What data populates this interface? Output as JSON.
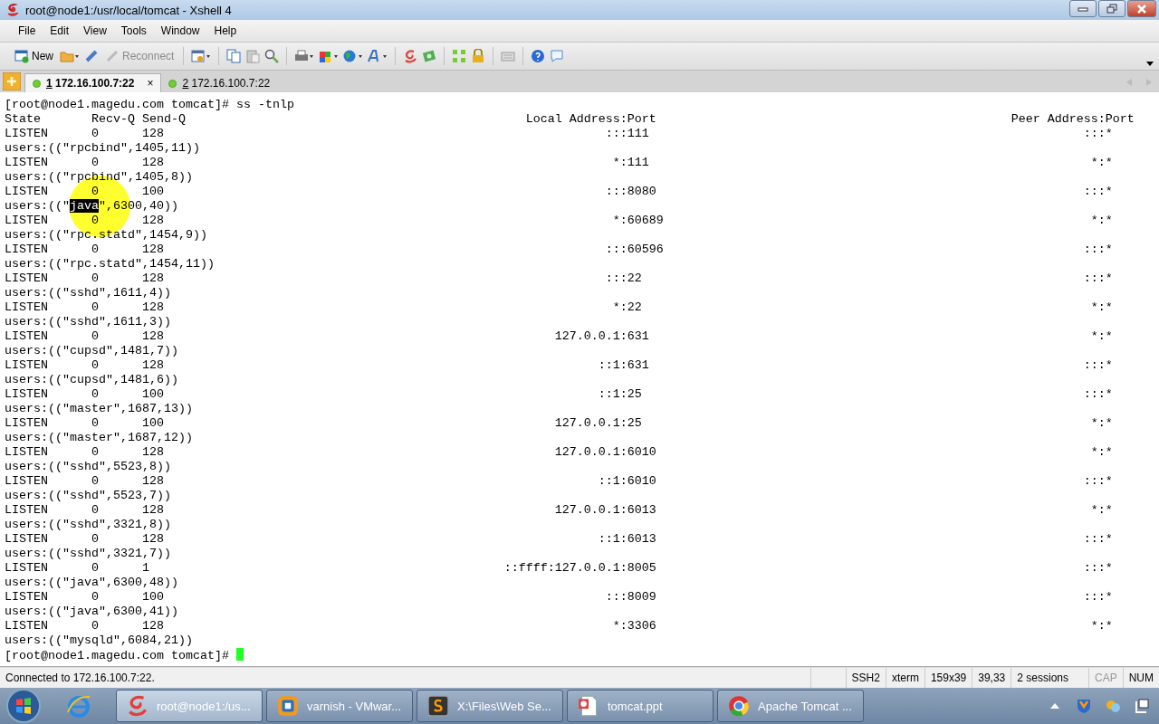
{
  "window": {
    "title": "root@node1:/usr/local/tomcat - Xshell 4"
  },
  "menu": [
    "File",
    "Edit",
    "View",
    "Tools",
    "Window",
    "Help"
  ],
  "toolbar": {
    "new_label": "New",
    "reconnect": {
      "label": "Reconnect",
      "disabled": true
    }
  },
  "tabs": [
    {
      "number": "1",
      "label": "172.16.100.7:22",
      "selected": true,
      "close": "×"
    },
    {
      "number": "2",
      "label": "172.16.100.7:22",
      "selected": false
    }
  ],
  "terminal": {
    "command_line": "[root@node1.magedu.com tomcat]# ss -tnlp",
    "header": {
      "state": "State",
      "recv_q": "Recv-Q",
      "send_q": "Send-Q",
      "local": "Local Address:Port",
      "peer": "Peer Address:Port"
    },
    "rows": [
      {
        "state": "LISTEN",
        "recv_q": "0",
        "send_q": "128",
        "local": ":::111",
        "peer": ":::*",
        "users": [
          {
            "text": "users:((\"rpcbind\",1405,11))",
            "selected": false
          }
        ]
      },
      {
        "state": "LISTEN",
        "recv_q": "0",
        "send_q": "128",
        "local": "*:111",
        "peer": "*:*",
        "users": [
          {
            "text": "users:((\"rpcbind\",1405,8))",
            "selected": false
          }
        ]
      },
      {
        "state": "LISTEN",
        "recv_q": "0",
        "send_q": "100",
        "local": ":::8080",
        "peer": ":::*",
        "users": [
          {
            "text": "users:((\"",
            "selected": false
          },
          {
            "text": "java",
            "selected": true
          },
          {
            "text": "\",6300,40))",
            "selected": false
          }
        ]
      },
      {
        "state": "LISTEN",
        "recv_q": "0",
        "send_q": "128",
        "local": "*:60689",
        "peer": "*:*",
        "users": [
          {
            "text": "users:((\"rpc.statd\",1454,9))",
            "selected": false
          }
        ]
      },
      {
        "state": "LISTEN",
        "recv_q": "0",
        "send_q": "128",
        "local": ":::60596",
        "peer": ":::*",
        "users": [
          {
            "text": "users:((\"rpc.statd\",1454,11))",
            "selected": false
          }
        ]
      },
      {
        "state": "LISTEN",
        "recv_q": "0",
        "send_q": "128",
        "local": ":::22",
        "peer": ":::*",
        "users": [
          {
            "text": "users:((\"sshd\",1611,4))",
            "selected": false
          }
        ]
      },
      {
        "state": "LISTEN",
        "recv_q": "0",
        "send_q": "128",
        "local": "*:22",
        "peer": "*:*",
        "users": [
          {
            "text": "users:((\"sshd\",1611,3))",
            "selected": false
          }
        ]
      },
      {
        "state": "LISTEN",
        "recv_q": "0",
        "send_q": "128",
        "local": "127.0.0.1:631",
        "peer": "*:*",
        "users": [
          {
            "text": "users:((\"cupsd\",1481,7))",
            "selected": false
          }
        ]
      },
      {
        "state": "LISTEN",
        "recv_q": "0",
        "send_q": "128",
        "local": "::1:631",
        "peer": ":::*",
        "users": [
          {
            "text": "users:((\"cupsd\",1481,6))",
            "selected": false
          }
        ]
      },
      {
        "state": "LISTEN",
        "recv_q": "0",
        "send_q": "100",
        "local": "::1:25",
        "peer": ":::*",
        "users": [
          {
            "text": "users:((\"master\",1687,13))",
            "selected": false
          }
        ]
      },
      {
        "state": "LISTEN",
        "recv_q": "0",
        "send_q": "100",
        "local": "127.0.0.1:25",
        "peer": "*:*",
        "users": [
          {
            "text": "users:((\"master\",1687,12))",
            "selected": false
          }
        ]
      },
      {
        "state": "LISTEN",
        "recv_q": "0",
        "send_q": "128",
        "local": "127.0.0.1:6010",
        "peer": "*:*",
        "users": [
          {
            "text": "users:((\"sshd\",5523,8))",
            "selected": false
          }
        ]
      },
      {
        "state": "LISTEN",
        "recv_q": "0",
        "send_q": "128",
        "local": "::1:6010",
        "peer": ":::*",
        "users": [
          {
            "text": "users:((\"sshd\",5523,7))",
            "selected": false
          }
        ]
      },
      {
        "state": "LISTEN",
        "recv_q": "0",
        "send_q": "128",
        "local": "127.0.0.1:6013",
        "peer": "*:*",
        "users": [
          {
            "text": "users:((\"sshd\",3321,8))",
            "selected": false
          }
        ]
      },
      {
        "state": "LISTEN",
        "recv_q": "0",
        "send_q": "128",
        "local": "::1:6013",
        "peer": ":::*",
        "users": [
          {
            "text": "users:((\"sshd\",3321,7))",
            "selected": false
          }
        ]
      },
      {
        "state": "LISTEN",
        "recv_q": "0",
        "send_q": "1",
        "local": "::ffff:127.0.0.1:8005",
        "peer": ":::*",
        "users": [
          {
            "text": "users:((\"java\",6300,48))",
            "selected": false
          }
        ]
      },
      {
        "state": "LISTEN",
        "recv_q": "0",
        "send_q": "100",
        "local": ":::8009",
        "peer": ":::*",
        "users": [
          {
            "text": "users:((\"java\",6300,41))",
            "selected": false
          }
        ]
      },
      {
        "state": "LISTEN",
        "recv_q": "0",
        "send_q": "128",
        "local": "*:3306",
        "peer": "*:*",
        "users": [
          {
            "text": "users:((\"mysqld\",6084,21))",
            "selected": false
          }
        ]
      }
    ],
    "prompt": "[root@node1.magedu.com tomcat]#"
  },
  "status_bar": {
    "message": "Connected to 172.16.100.7:22.",
    "cells": [
      {
        "text": "SSH2",
        "enabled": true
      },
      {
        "text": "xterm",
        "enabled": true
      },
      {
        "text": "159x39",
        "enabled": true
      },
      {
        "text": "39,33",
        "enabled": true
      },
      {
        "text": "2 sessions",
        "enabled": true
      },
      {
        "text": "CAP",
        "enabled": false
      },
      {
        "text": "NUM",
        "enabled": true
      }
    ]
  },
  "taskbar": {
    "tasks": [
      {
        "label": "root@node1:/us...",
        "selected": true
      },
      {
        "label": "varnish - VMwar...",
        "selected": false
      },
      {
        "label": "X:\\Files\\Web Se...",
        "selected": false
      },
      {
        "label": "tomcat.ppt",
        "selected": false
      },
      {
        "label": "Apache Tomcat ...",
        "selected": false
      }
    ]
  }
}
